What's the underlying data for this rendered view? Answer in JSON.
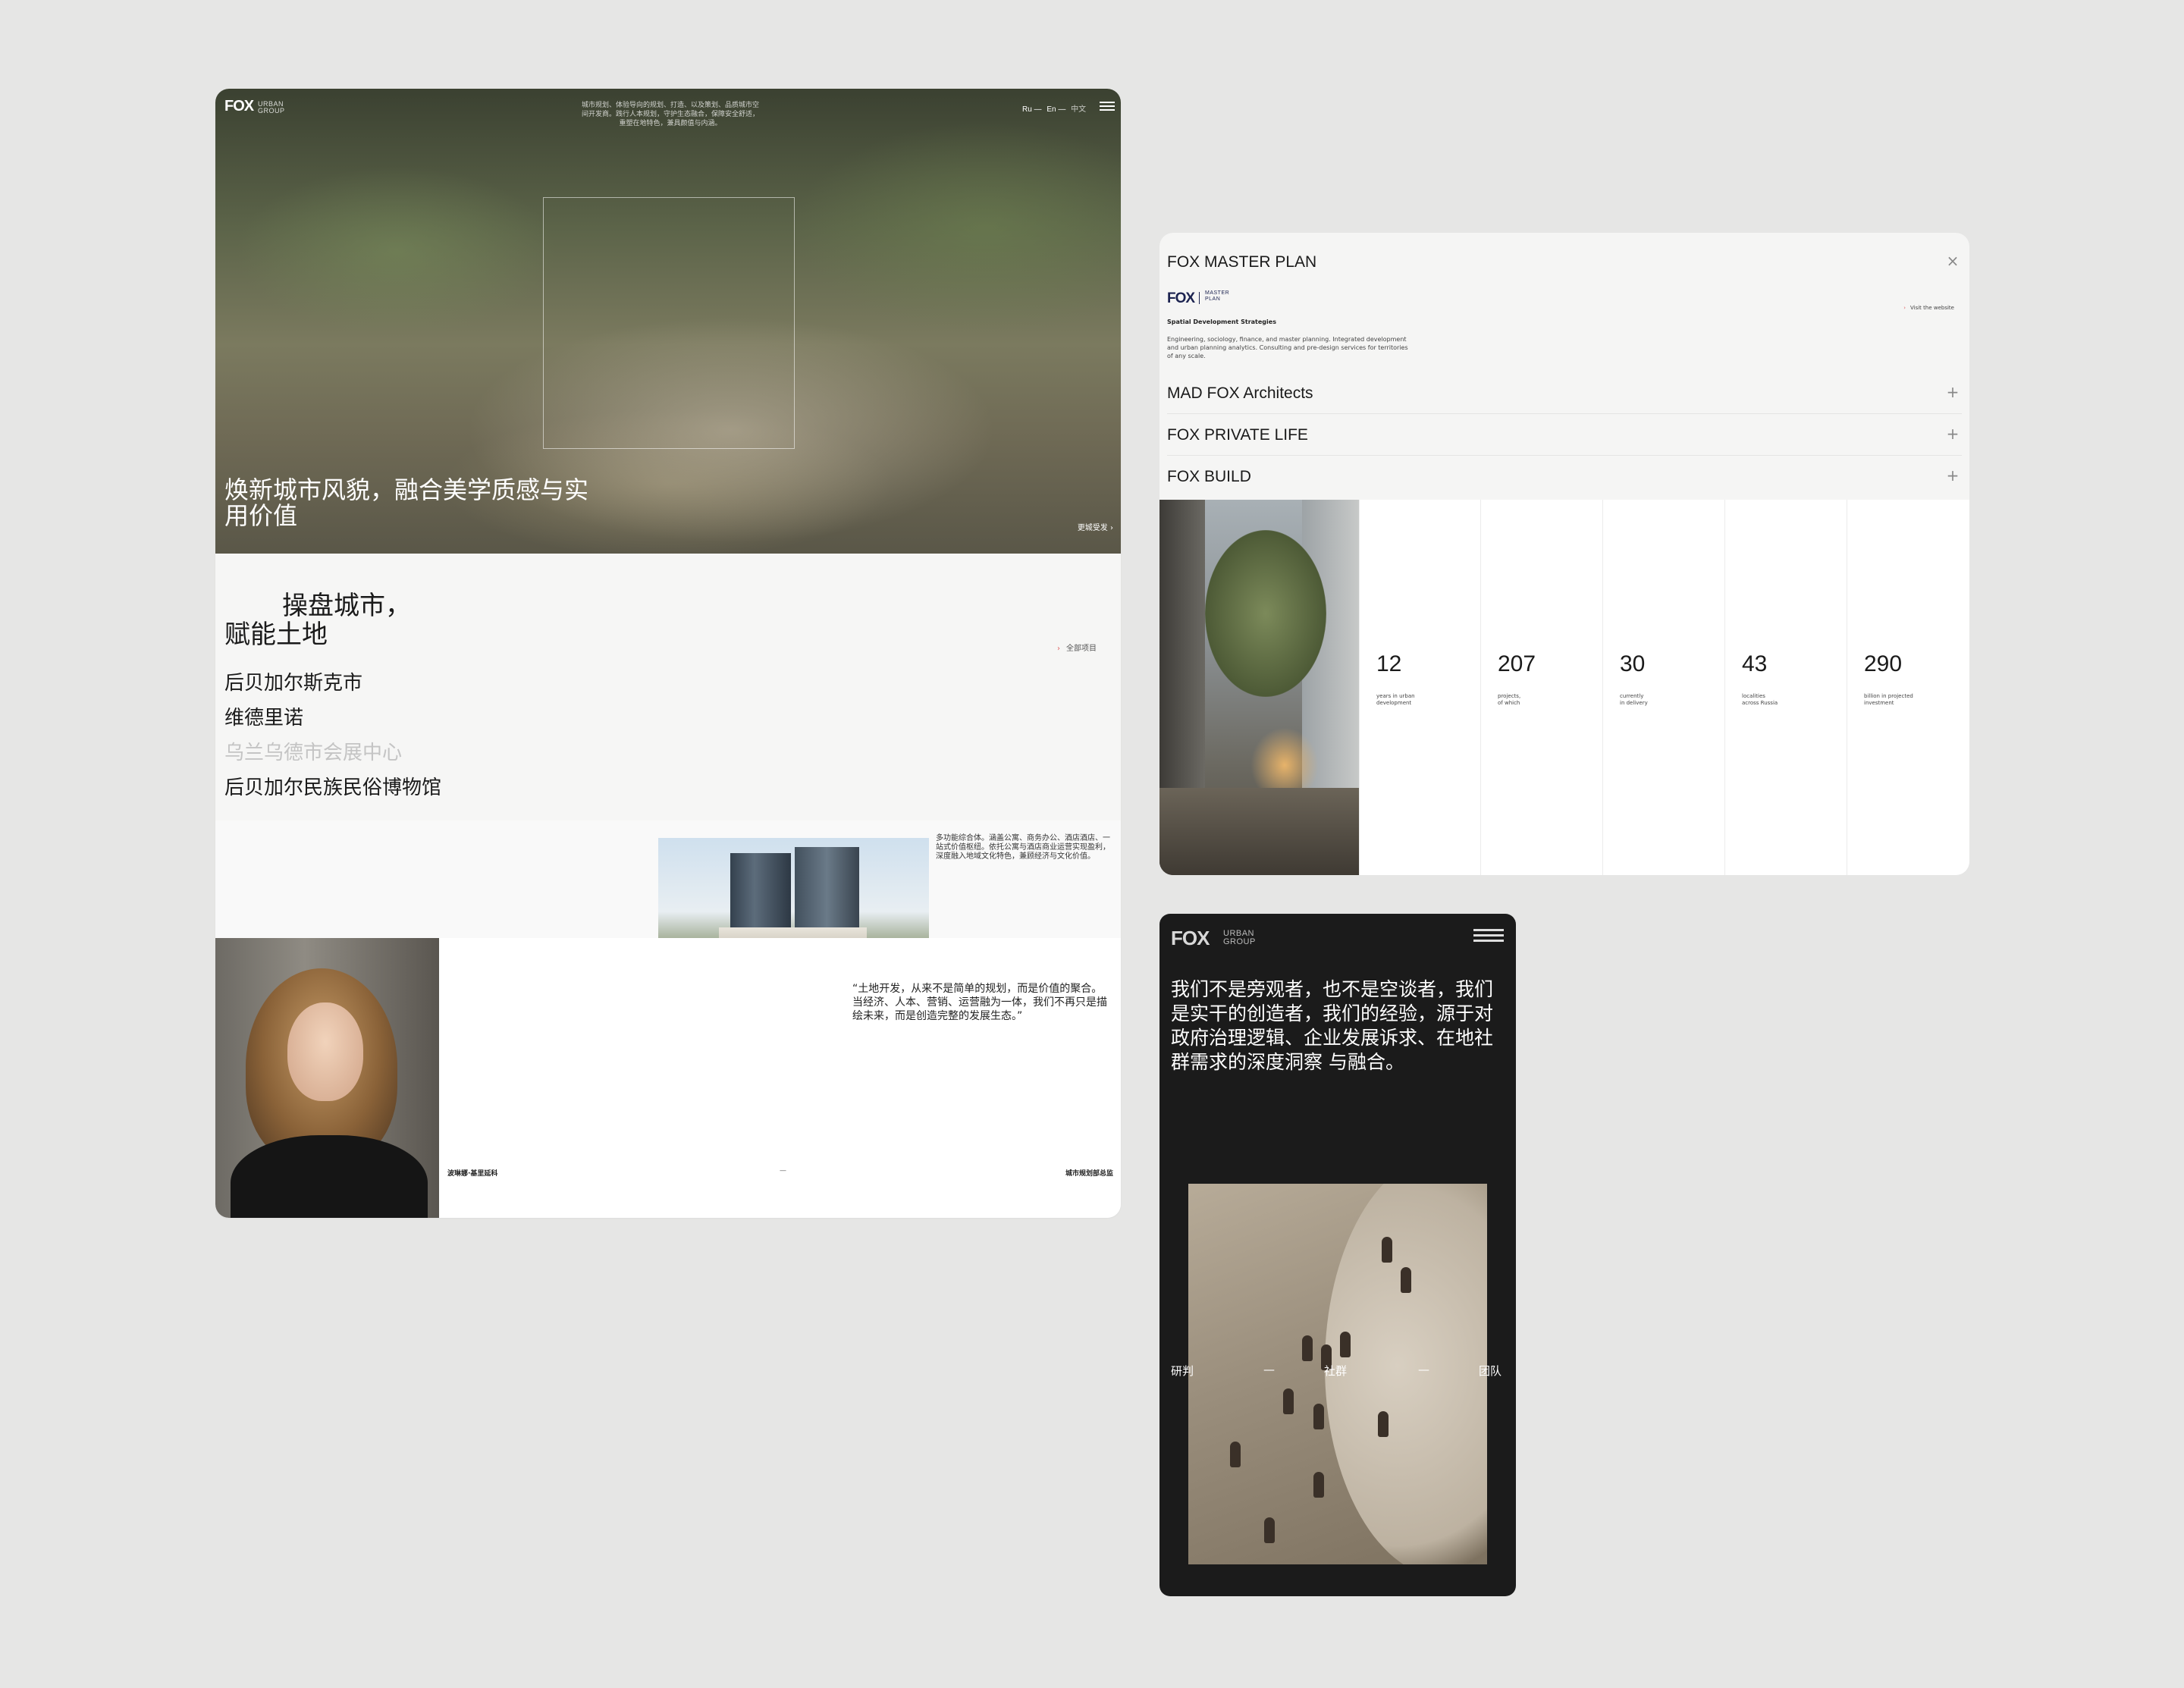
{
  "left_card": {
    "header": {
      "logo": "FOX",
      "logo_sub_1": "URBAN",
      "logo_sub_2": "GROUP",
      "description": "城市规划、体验导向的规划、打造、以及策划、品质城市空间开发商。践行人本规划，守护生态融合，保障安全舒适，重塑在地特色，兼具颜值与内涵。",
      "lang_ru": "Ru —",
      "lang_en": "En —",
      "lang_zh": "中文"
    },
    "hero": {
      "title": "焕新城市风貌，融合美学质感与实用价值",
      "link": "更城受发 ›"
    },
    "projects": {
      "heading_line1": "操盘城市，",
      "heading_line2": "赋能土地",
      "all_link_arrow": "›",
      "all_link": "全部项目",
      "items": [
        {
          "label": "后贝加尔斯克市"
        },
        {
          "label": "维德里诺"
        },
        {
          "label": "乌兰乌德市会展中心"
        },
        {
          "label": "后贝加尔民族民俗博物馆"
        }
      ],
      "description": "多功能综合体。涵盖公寓、商务办公、酒店酒店、一站式价值枢纽。依托公寓与酒店商业运营实现盈利，深度融入地域文化特色，兼顾经济与文化价值。"
    },
    "team": {
      "quote": "“土地开发，从来不是简单的规划，而是价值的聚合。当经济、人本、营销、运营融为一体，我们不再只是描绘未来，而是创造完整的发展生态。”",
      "name": "波琳娜·基里延科",
      "dash": "—",
      "role": "城市规划部总监"
    }
  },
  "right_top_card": {
    "accordion": [
      {
        "title": "FOX MASTER PLAN",
        "icon": "close-icon"
      },
      {
        "title": "MAD FOX Architects",
        "icon": "plus-icon"
      },
      {
        "title": "FOX PRIVATE LIFE",
        "icon": "plus-icon"
      },
      {
        "title": "FOX BUILD",
        "icon": "plus-icon"
      }
    ],
    "master_plan": {
      "logo": "FOX",
      "logo_sub_1": "MASTER",
      "logo_sub_2": "PLAN",
      "tag": "Spatial Development Strategies",
      "description": "Engineering, sociology, finance, and master planning. Integrated development and urban planning analytics. Consulting and pre-design services for territories of any scale.",
      "visit_arrow": "›",
      "visit": "Visit the website"
    },
    "stats": [
      {
        "value": "12",
        "label": "years in urban\ndevelopment"
      },
      {
        "value": "207",
        "label": "projects,\nof which"
      },
      {
        "value": "30",
        "label": "currently\nin delivery"
      },
      {
        "value": "43",
        "label": "localities\nacross Russia"
      },
      {
        "value": "290",
        "label": "billion in projected\ninvestment"
      }
    ]
  },
  "right_bottom_card": {
    "logo": "FOX",
    "logo_sub_1": "URBAN",
    "logo_sub_2": "GROUP",
    "statement": "我们不是旁观者，也不是空谈者，我们是实干的创造者，我们的经验，源于对政府治理逻辑、企业发展诉求、在地社群需求的深度洞察 与融合。",
    "labels": {
      "left": "研判",
      "dash1": "—",
      "center": "社群",
      "dash2": "—",
      "right": "团队"
    }
  }
}
